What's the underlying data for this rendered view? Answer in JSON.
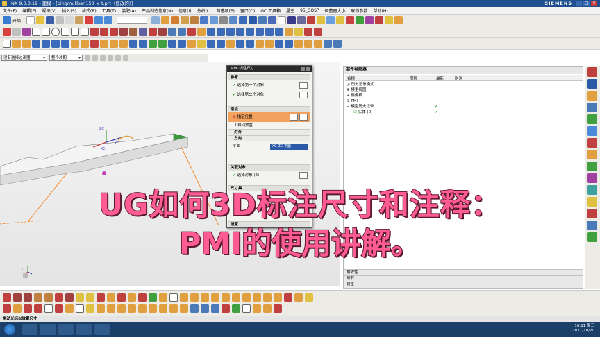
{
  "window": {
    "title": "NX 9.0.0.19 - 建模 - [pingmuliban150_x_t.prt（修改的）]",
    "brand": "SIEMENS"
  },
  "menu": [
    "文件(F)",
    "编辑(E)",
    "视图(V)",
    "插入(S)",
    "格式(R)",
    "工具(T)",
    "装配(A)",
    "产品制造信息(N)",
    "信息(I)",
    "分析(L)",
    "首选项(P)",
    "窗口(O)",
    "GC 工具箱",
    "星空",
    "95_GOSP",
    "调整窗大小",
    "联粉参数",
    "帮助(H)"
  ],
  "toolbar": {
    "start_label": "开始",
    "command_search_value": ""
  },
  "selection": {
    "filter": "没有选择过滤器",
    "scope": "整个装配"
  },
  "dialog": {
    "title": "PMI 线性尺寸",
    "sections": {
      "reference": "参考",
      "origin": "原点",
      "align": "对齐",
      "orientation": "方向",
      "associated": "关联对象",
      "dimension_set": "尺寸集",
      "settings": "设置"
    },
    "rows": {
      "select_first": "选择第一个对象",
      "select_second": "选择第二个对象",
      "specify_location": "指定位置",
      "auto_place": "自动放置",
      "plane_label": "平面",
      "plane_value": "XC-ZC 平面",
      "select_object": "选择对象 (2)"
    }
  },
  "navigator": {
    "title": "部件导航器",
    "columns": [
      "名称",
      "图层",
      "最新",
      "附注"
    ],
    "items": [
      {
        "label": "历史记录模式",
        "latest": ""
      },
      {
        "label": "模型视图",
        "latest": ""
      },
      {
        "label": "摄像机",
        "latest": ""
      },
      {
        "label": "PMI",
        "latest": ""
      },
      {
        "label": "模型历史记录",
        "latest": "✔"
      },
      {
        "label": "实体 (0)",
        "latest": "✔"
      }
    ],
    "bottom_panels": [
      "相依性",
      "细节",
      "预览"
    ]
  },
  "viewport": {
    "triad": [
      "ZC",
      "YC",
      "XC"
    ],
    "csys_label": "X"
  },
  "statusbar": {
    "text": "拖动光标以放置尺寸"
  },
  "taskbar": {
    "time": "16:11 周三",
    "date": "2021/10/20"
  },
  "overlay": {
    "line1": "UG如何3D标注尺寸和注释：",
    "line2": "PMI的使用讲解。"
  },
  "colors": {
    "titlebar": "#1f4f8f",
    "highlight": "#f2a25c",
    "overlay_text": "#ff5c96",
    "check": "#1a9a1a"
  }
}
